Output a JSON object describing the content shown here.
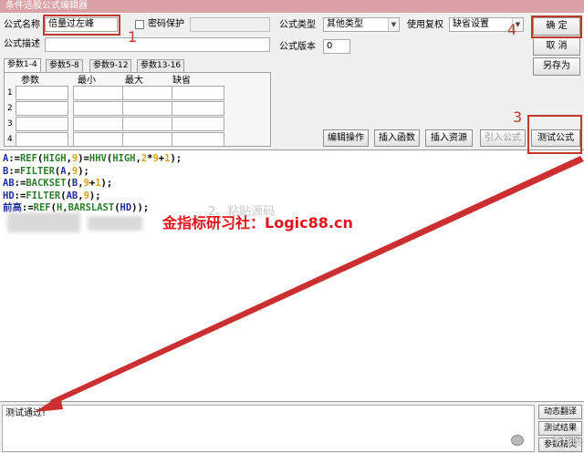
{
  "window": {
    "title": "条件选股公式编辑器"
  },
  "form": {
    "name_label": "公式名称",
    "name_value": "倍量过左峰",
    "password_label": "密码保护",
    "desc_label": "公式描述",
    "type_label": "公式类型",
    "type_value": "其他类型",
    "version_label": "公式版本",
    "version_value": "0",
    "rights_label": "使用复权",
    "rights_value": "缺省设置"
  },
  "buttons": {
    "confirm": "确  定",
    "cancel": "取  消",
    "save_as": "另存为",
    "edit_op": "编辑操作",
    "insert_func": "插入函数",
    "insert_res": "插入资源",
    "import_formula": "引入公式",
    "test_formula": "测试公式",
    "dynamic_translate": "动态翻译",
    "test_result": "测试结果",
    "param_wizard": "参数精灵"
  },
  "params": {
    "tabs": [
      "参数1-4",
      "参数5-8",
      "参数9-12",
      "参数13-16"
    ],
    "headers": [
      "参数",
      "最小",
      "最大",
      "缺省"
    ],
    "rows": [
      "1",
      "2",
      "3",
      "4"
    ]
  },
  "code": {
    "lines": [
      [
        {
          "t": "A",
          "c": "vr"
        },
        {
          "t": ":=",
          "c": ""
        },
        {
          "t": "REF",
          "c": "kw"
        },
        {
          "t": "(",
          "c": ""
        },
        {
          "t": "HIGH",
          "c": "kw"
        },
        {
          "t": ",",
          "c": ""
        },
        {
          "t": "9",
          "c": "nm"
        },
        {
          "t": ")=",
          "c": ""
        },
        {
          "t": "HHV",
          "c": "kw"
        },
        {
          "t": "(",
          "c": ""
        },
        {
          "t": "HIGH",
          "c": "kw"
        },
        {
          "t": ",",
          "c": ""
        },
        {
          "t": "2",
          "c": "nm"
        },
        {
          "t": "*",
          "c": ""
        },
        {
          "t": "9",
          "c": "nm"
        },
        {
          "t": "+",
          "c": ""
        },
        {
          "t": "1",
          "c": "nm"
        },
        {
          "t": ");",
          "c": ""
        }
      ],
      [
        {
          "t": "B",
          "c": "vr"
        },
        {
          "t": ":=",
          "c": ""
        },
        {
          "t": "FILTER",
          "c": "kw"
        },
        {
          "t": "(",
          "c": ""
        },
        {
          "t": "A",
          "c": "vr"
        },
        {
          "t": ",",
          "c": ""
        },
        {
          "t": "9",
          "c": "nm"
        },
        {
          "t": ");",
          "c": ""
        }
      ],
      [
        {
          "t": "AB",
          "c": "vr"
        },
        {
          "t": ":=",
          "c": ""
        },
        {
          "t": "BACKSET",
          "c": "kw"
        },
        {
          "t": "(",
          "c": ""
        },
        {
          "t": "B",
          "c": "vr"
        },
        {
          "t": ",",
          "c": ""
        },
        {
          "t": "9",
          "c": "nm"
        },
        {
          "t": "+",
          "c": ""
        },
        {
          "t": "1",
          "c": "nm"
        },
        {
          "t": ");",
          "c": ""
        }
      ],
      [
        {
          "t": "HD",
          "c": "vr"
        },
        {
          "t": ":=",
          "c": ""
        },
        {
          "t": "FILTER",
          "c": "kw"
        },
        {
          "t": "(",
          "c": ""
        },
        {
          "t": "AB",
          "c": "vr"
        },
        {
          "t": ",",
          "c": ""
        },
        {
          "t": "9",
          "c": "nm"
        },
        {
          "t": ");",
          "c": ""
        }
      ],
      [
        {
          "t": "前高",
          "c": "vr"
        },
        {
          "t": ":=",
          "c": ""
        },
        {
          "t": "REF",
          "c": "kw"
        },
        {
          "t": "(",
          "c": ""
        },
        {
          "t": "H",
          "c": "kw"
        },
        {
          "t": ",",
          "c": ""
        },
        {
          "t": "BARSLAST",
          "c": "kw"
        },
        {
          "t": "(",
          "c": ""
        },
        {
          "t": "HD",
          "c": "vr"
        },
        {
          "t": "));",
          "c": ""
        }
      ]
    ]
  },
  "overlays": {
    "watermark": "金指标研习社：Logic88.cn",
    "paste_hint": "2、粘贴源码",
    "steps": [
      "1",
      "3",
      "4"
    ],
    "corner_text": "李翔股"
  },
  "status": {
    "result_text": "测试通过!"
  },
  "colors": {
    "highlight": "#c0392b",
    "watermark": "#e4141b",
    "keyword": "#2a7e2a",
    "variable": "#1e2f9c",
    "number": "#e0a014"
  }
}
